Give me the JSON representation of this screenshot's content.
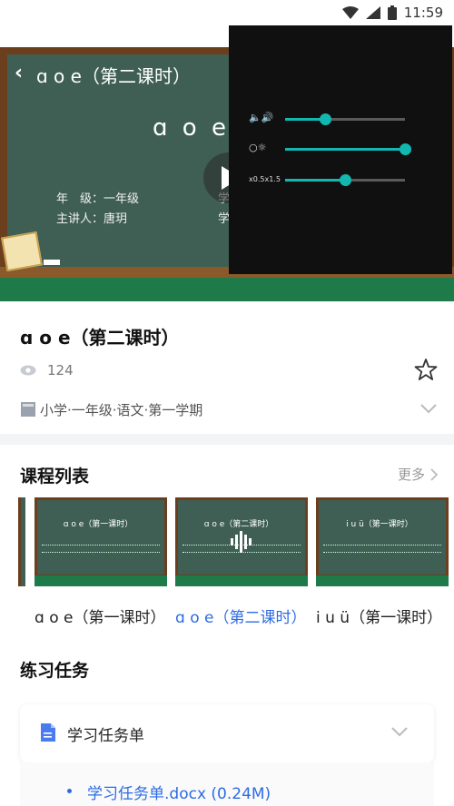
{
  "status_bar": {
    "time": "11:59"
  },
  "player": {
    "back_icon": "chevron-left-icon",
    "video_title": "ɑ o e（第二课时）",
    "board_title": "ɑ o e",
    "info_grade": "年　级：一年级",
    "info_teacher": "主讲人：唐玥",
    "info_right_1": "学",
    "info_right_2": "学",
    "controls": {
      "volume_label": "🔈🔊",
      "volume_level": 0.33,
      "brightness_label": "○☼",
      "brightness_level": 1.0,
      "speed_label": "x0.5x1.5",
      "speed_level": 0.5
    }
  },
  "lesson": {
    "title": "ɑ o e（第二课时）",
    "view_count": "124",
    "breadcrumb": "小学·一年级·语文·第一学期"
  },
  "course_list": {
    "heading": "课程列表",
    "more_label": "更多",
    "items": [
      {
        "caption": "ɑ o e（第一课时）",
        "board": "ɑ o e（第一课时）",
        "active": false
      },
      {
        "caption": "ɑ o e（第二课时）",
        "board": "ɑ o e（第二课时）",
        "active": true
      },
      {
        "caption": "i u ü（第一课时）",
        "board": "i u ü（第一课时）",
        "active": false
      }
    ]
  },
  "practice": {
    "heading": "练习任务",
    "task_name": "学习任务单",
    "file_name": "学习任务单.docx (0.24M)"
  },
  "colors": {
    "accent": "#2d6be4",
    "slider": "#12b8b0",
    "board": "#3f5f54"
  }
}
